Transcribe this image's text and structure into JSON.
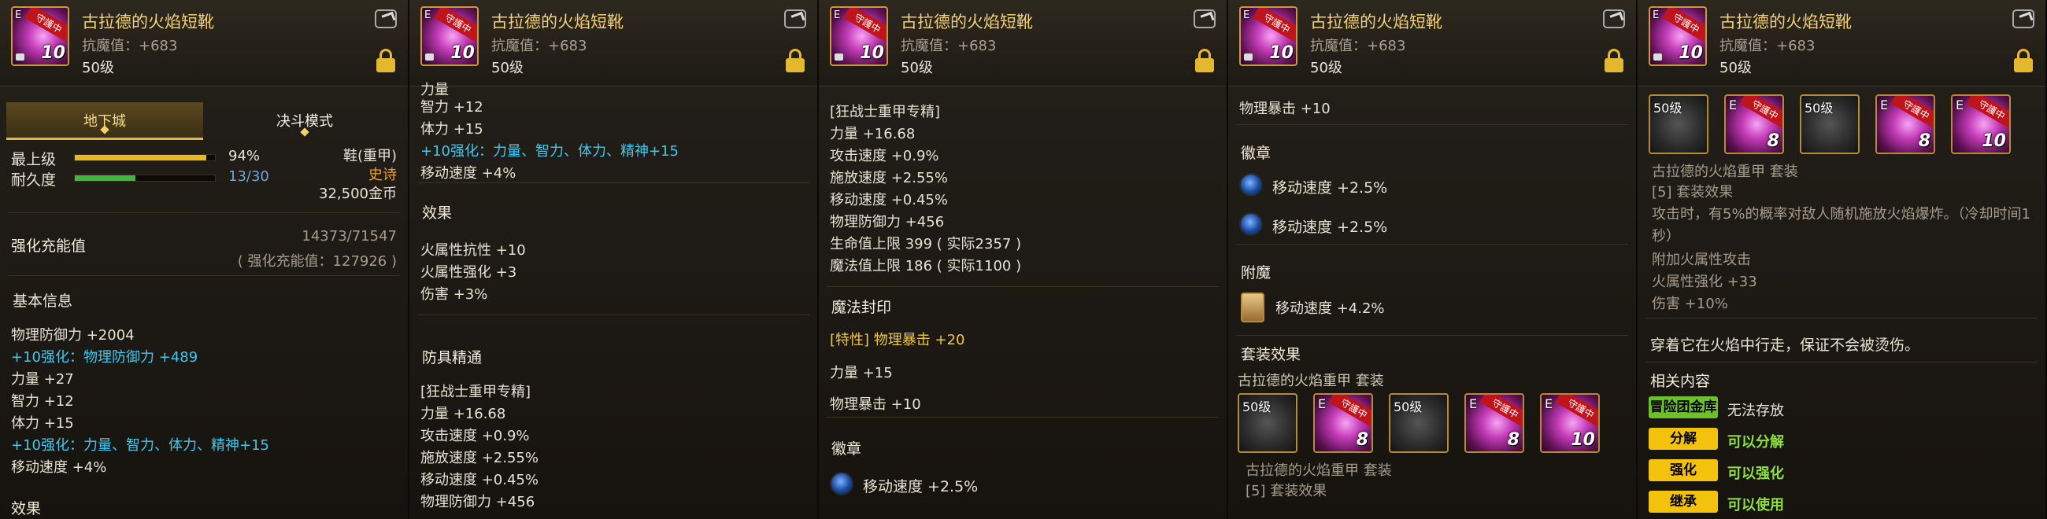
{
  "item": {
    "name": "古拉德的火焰短靴",
    "magic_def": "抗魔值：+683",
    "level": "50级",
    "thumb_sub": "E",
    "thumb_tag": "守護中",
    "thumb_lvl": "10"
  },
  "p1": {
    "tabs": [
      "地下城",
      "决斗模式"
    ],
    "grade_label": "最上级",
    "grade_pct": "94%",
    "grade_value": 0.94,
    "durability_label": "耐久度",
    "durability_value": "13/30",
    "durability_fraction": 0.4333,
    "type": "鞋(重甲)",
    "rarity": "史诗",
    "price": "32,500金币",
    "charge_label": "强化充能值",
    "charge_value": "14373/71547",
    "charge_note": "( 强化充能值：127926 )",
    "basic_title": "基本信息",
    "lines": [
      "物理防御力 +2004",
      "+10强化：物理防御力 +489",
      "力量 +27",
      "智力 +12",
      "体力 +15",
      "+10强化：力量、智力、体力、精神+15",
      "移动速度 +4%"
    ],
    "cut": "效果"
  },
  "p2": {
    "cut_top": "力量",
    "lines": [
      "智力 +12",
      "体力 +15",
      "+10强化：力量、智力、体力、精神+15",
      "移动速度 +4%"
    ],
    "effect_title": "效果",
    "effects": [
      "火属性抗性 +10",
      "火属性强化 +3",
      "伤害 +3%"
    ],
    "armor_title": "防具精通",
    "armor_lines": [
      "[狂战士重甲专精]",
      "力量 +16.68",
      "攻击速度 +0.9%",
      "施放速度 +2.55%",
      "移动速度 +0.45%",
      "物理防御力 +456"
    ]
  },
  "p3": {
    "lines": [
      "[狂战士重甲专精]",
      "力量 +16.68",
      "攻击速度 +0.9%",
      "施放速度 +2.55%",
      "移动速度 +0.45%",
      "物理防御力 +456",
      "生命值上限 399 ( 实际2357 )",
      "魔法值上限 186 ( 实际1100 )"
    ],
    "seal_title": "魔法封印",
    "seal_trait": "[特性] 物理暴击 +20",
    "seal_lines": [
      "力量 +15",
      "物理暴击 +10"
    ],
    "emblem_title": "徽章",
    "emblem_lines": [
      "移动速度 +2.5%"
    ]
  },
  "p4": {
    "top_line": "物理暴击 +10",
    "emblem_title": "徽章",
    "emblems": [
      "移动速度 +2.5%",
      "移动速度 +2.5%"
    ],
    "enchant_title": "附魔",
    "enchant": "移动速度 +4.2%",
    "set_title": "套装效果",
    "set_name": "古拉德的火焰重甲 套装",
    "slots": [
      {
        "lvl": "50级"
      },
      {
        "num": "8"
      },
      {
        "lvl": "50级"
      },
      {
        "num": "8"
      },
      {
        "num": "10"
      }
    ],
    "set_item_line": "古拉德的火焰重甲 套装",
    "set_bonus": "[5] 套装效果"
  },
  "p5": {
    "slots": [
      {
        "lvl": "50级"
      },
      {
        "num": "8"
      },
      {
        "lvl": "50级"
      },
      {
        "num": "8"
      },
      {
        "num": "10"
      }
    ],
    "set_item_line": "古拉德的火焰重甲 套装",
    "set_bonus": "[5] 套装效果",
    "desc1": "攻击时，有5%的概率对敌人随机施放火焰爆炸。（冷却时间1",
    "desc2": "秒）",
    "lines": [
      "附加火属性攻击",
      "火属性强化 +33",
      "伤害 +10%"
    ],
    "flavor": "穿着它在火焰中行走，保证不会被烫伤。",
    "related_title": "相关内容",
    "related": [
      {
        "label": "冒险团金库",
        "status": "无法存放",
        "color": "#6cc02c",
        "status_color": "#e8e2d4"
      },
      {
        "label": "分解",
        "status": "可以分解",
        "color": "#f2c20c",
        "status_color": "#8fe23c"
      },
      {
        "label": "强化",
        "status": "可以强化",
        "color": "#f2c20c",
        "status_color": "#8fe23c"
      },
      {
        "label": "继承",
        "status": "可以使用",
        "color": "#f2c20c",
        "status_color": "#8fe23c"
      }
    ]
  },
  "colors": {
    "gold": "#f3d17a",
    "cyan": "#41c8ee",
    "green": "#8fe23c",
    "orange_epic": "#f0a030"
  }
}
